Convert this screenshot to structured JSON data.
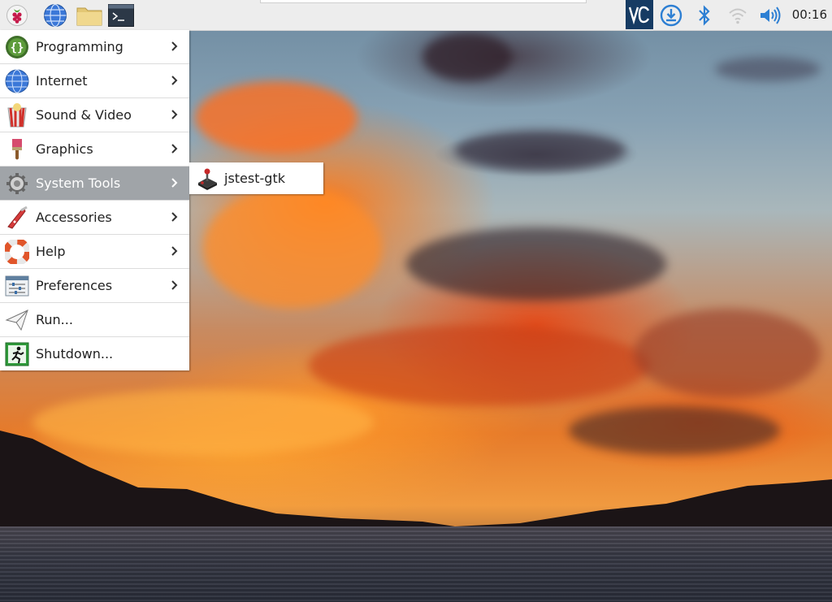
{
  "panel": {
    "launchers": [
      {
        "icon": "raspberry-pi-menu-icon"
      },
      {
        "icon": "web-browser-icon"
      },
      {
        "icon": "file-manager-icon"
      },
      {
        "icon": "terminal-icon"
      }
    ],
    "tray": [
      {
        "icon": "vnc-icon"
      },
      {
        "icon": "updates-download-icon"
      },
      {
        "icon": "bluetooth-icon"
      },
      {
        "icon": "wifi-icon"
      },
      {
        "icon": "volume-icon"
      }
    ],
    "clock": "00:16"
  },
  "menu": {
    "items": [
      {
        "label": "Programming",
        "icon": "programming-icon",
        "submenu": true
      },
      {
        "label": "Internet",
        "icon": "internet-globe-icon",
        "submenu": true
      },
      {
        "label": "Sound & Video",
        "icon": "sound-video-icon",
        "submenu": true
      },
      {
        "label": "Graphics",
        "icon": "graphics-brush-icon",
        "submenu": true
      },
      {
        "label": "System Tools",
        "icon": "system-tools-gear-icon",
        "submenu": true,
        "active": true
      },
      {
        "label": "Accessories",
        "icon": "accessories-knife-icon",
        "submenu": true
      },
      {
        "label": "Help",
        "icon": "help-lifebuoy-icon",
        "submenu": true
      },
      {
        "label": "Preferences",
        "icon": "preferences-sliders-icon",
        "submenu": true
      },
      {
        "label": "Run...",
        "icon": "run-paper-plane-icon",
        "submenu": false
      },
      {
        "label": "Shutdown...",
        "icon": "shutdown-exit-icon",
        "submenu": false
      }
    ]
  },
  "submenu": {
    "items": [
      {
        "label": "jstest-gtk",
        "icon": "joystick-icon"
      }
    ]
  },
  "colors": {
    "panel_bg": "#ededed",
    "menu_bg": "#ffffff",
    "menu_active_bg": "#a0a4a8",
    "accent_blue": "#2d7fd3"
  }
}
